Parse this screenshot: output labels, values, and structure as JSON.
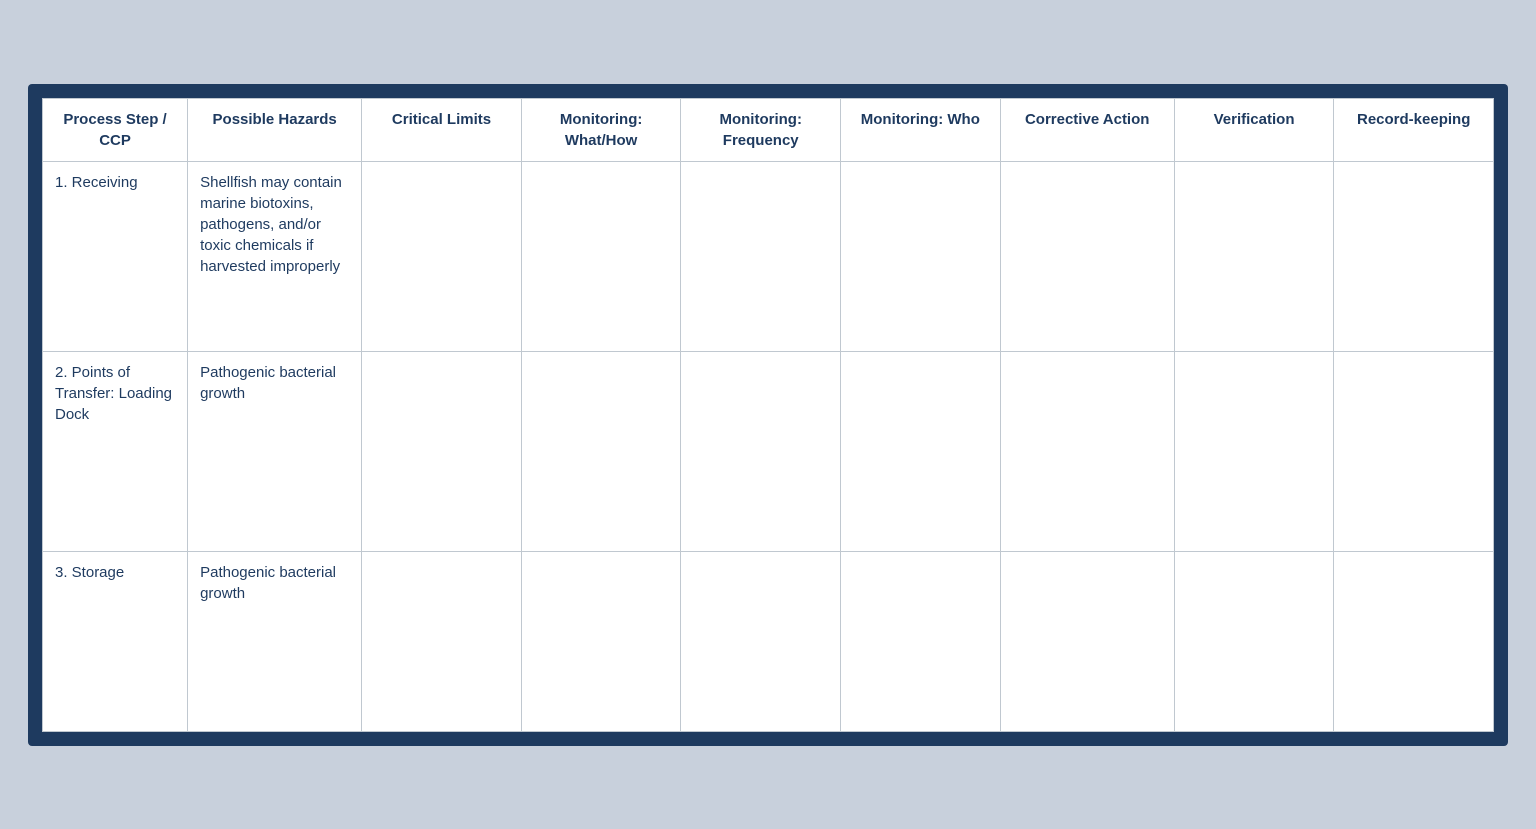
{
  "table": {
    "headers": [
      {
        "id": "process-step",
        "label": "Process Step / CCP"
      },
      {
        "id": "possible-hazards",
        "label": "Possible Hazards"
      },
      {
        "id": "critical-limits",
        "label": "Critical Limits"
      },
      {
        "id": "monitoring-what",
        "label": "Monitoring: What/How"
      },
      {
        "id": "monitoring-freq",
        "label": "Monitoring: Frequency"
      },
      {
        "id": "monitoring-who",
        "label": "Monitoring: Who"
      },
      {
        "id": "corrective-action",
        "label": "Corrective Action"
      },
      {
        "id": "verification",
        "label": "Verification"
      },
      {
        "id": "recordkeeping",
        "label": "Record-keeping"
      }
    ],
    "rows": [
      {
        "id": "receiving",
        "process_step": "1.    Receiving",
        "possible_hazards": "Shellfish may contain marine biotoxins, pathogens, and/or toxic chemicals if harvested improperly",
        "critical_limits": "",
        "monitoring_what": "",
        "monitoring_freq": "",
        "monitoring_who": "",
        "corrective_action": "",
        "verification": "",
        "recordkeeping": ""
      },
      {
        "id": "points-of-transfer",
        "process_step": "2.    Points of Transfer: Loading Dock",
        "possible_hazards": "Pathogenic bacterial growth",
        "critical_limits": "",
        "monitoring_what": "",
        "monitoring_freq": "",
        "monitoring_who": "",
        "corrective_action": "",
        "verification": "",
        "recordkeeping": ""
      },
      {
        "id": "storage",
        "process_step": "3.    Storage",
        "possible_hazards": "Pathogenic bacterial growth",
        "critical_limits": "",
        "monitoring_what": "",
        "monitoring_freq": "",
        "monitoring_who": "",
        "corrective_action": "",
        "verification": "",
        "recordkeeping": ""
      }
    ]
  }
}
